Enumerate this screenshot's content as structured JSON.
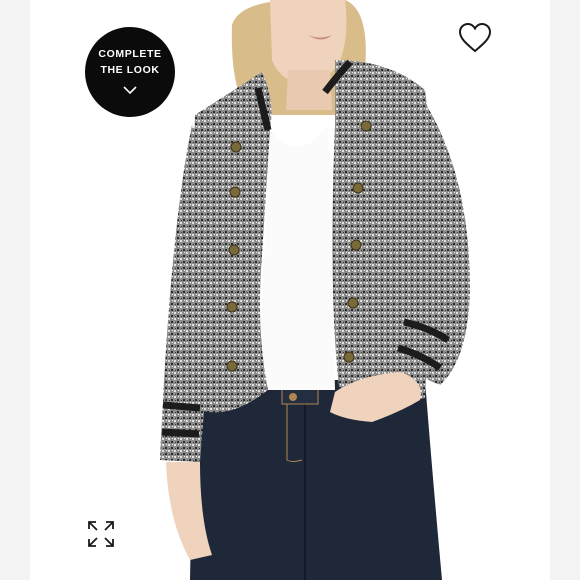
{
  "product_image": {
    "alt": "",
    "colors": {
      "jacket": "#8b8b8b",
      "trim": "#1c1c1c",
      "buttons": "#7a6a3a",
      "shirt": "#fbfbfb",
      "jeans": "#1f2838",
      "skin": "#efd3bd",
      "hair": "#d8bd8a"
    }
  },
  "badge": {
    "line1": "COMPLETE",
    "line2": "THE LOOK",
    "icon": "chevron-down-icon",
    "background": "#0b0b0b",
    "text_color": "#ffffff"
  },
  "wishlist": {
    "icon": "heart-outline-icon",
    "color": "#1a1a1a"
  },
  "expand": {
    "icon": "expand-arrows-icon",
    "color": "#1a1a1a"
  }
}
